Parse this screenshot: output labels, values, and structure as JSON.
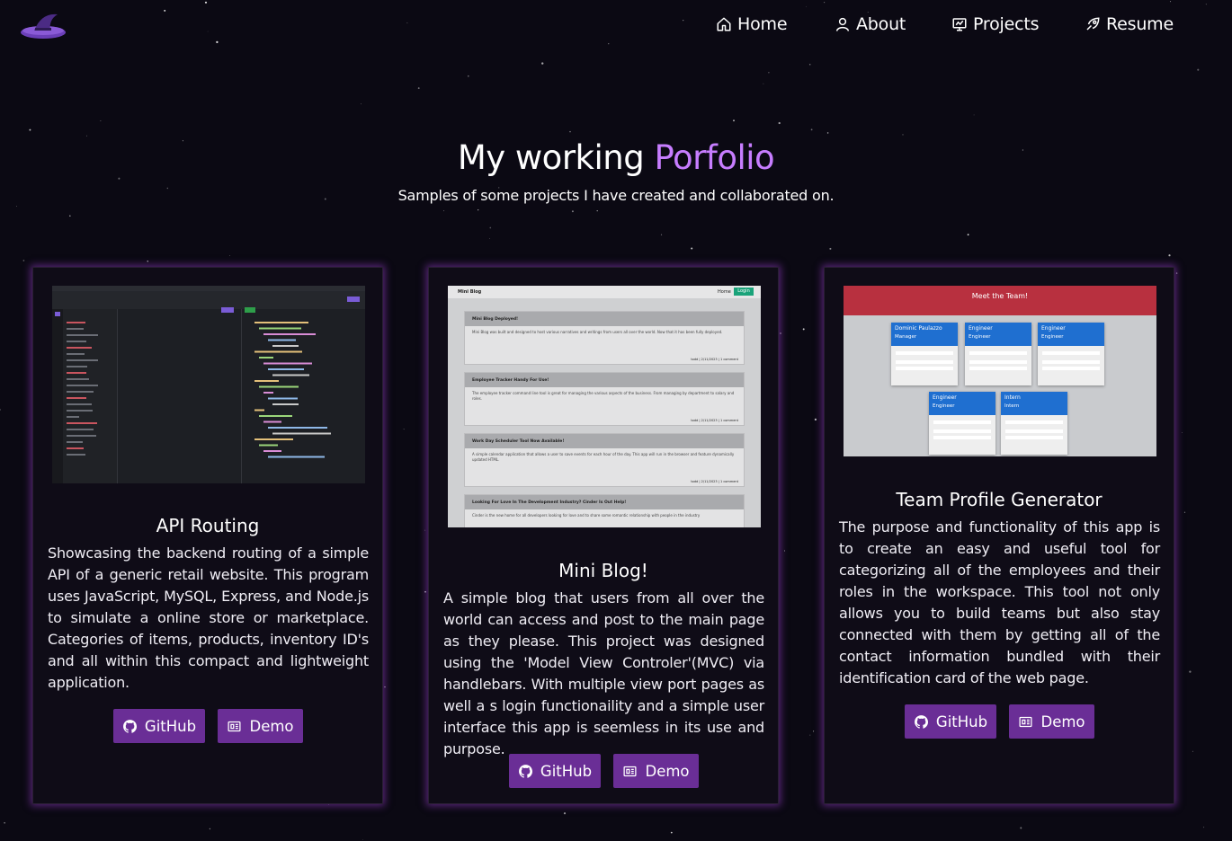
{
  "nav": {
    "items": [
      {
        "label": "Home",
        "icon": "home-icon"
      },
      {
        "label": "About",
        "icon": "user-icon"
      },
      {
        "label": "Projects",
        "icon": "projects-icon"
      },
      {
        "label": "Resume",
        "icon": "resume-icon"
      }
    ]
  },
  "hero": {
    "title_prefix": "My working ",
    "title_accent": "Porfolio",
    "subtitle": "Samples of some projects I have created and collaborated on."
  },
  "colors": {
    "background": "#0b0913",
    "accent": "#c77dff",
    "button": "#6a2e96",
    "card_glow": "#9c3cc8"
  },
  "projects": [
    {
      "title": "API Routing",
      "description": "Showcasing the backend routing of a simple API of a generic retail website. This program uses JavaScript, MySQL, Express, and Node.js to simulate a online store or marketplace. Categories of items, products, inventory ID's and all within this compact and lightweight application.",
      "github_label": "GitHub",
      "demo_label": "Demo"
    },
    {
      "title": "Mini Blog!",
      "description": "A simple blog that users from all over the world can access and post to the main page as they please. This project was designed using the 'Model View Controler'(MVC) via handlebars. With multiple view port pages as well a s login functionaility and a simple user interface this app is seemless in its use and purpose.",
      "github_label": "GitHub",
      "demo_label": "Demo",
      "screenshot": {
        "brand": "Mini Blog",
        "nav_home": "Home",
        "nav_login": "Login",
        "posts": [
          {
            "title": "Mini Blog Deployed!",
            "body": "Mini Blog was built and designed to host various narratives and writings from users all over the world. Now that it has been fully deployed.",
            "meta": "todd | 2/11/2023 | 1 comment"
          },
          {
            "title": "Employee Tracker Handy For Use!",
            "body": "The employee tracker command line tool is great for managing the various aspects of the business. From managing by department to salary and roles.",
            "meta": "todd | 2/11/2023 | 1 comment"
          },
          {
            "title": "Work Day Scheduler Tool Now Available!",
            "body": "A simple calendar application that allows a user to save events for each hour of the day. This app will run in the browser and feature dynamically updated HTML.",
            "meta": "todd | 2/11/2023 | 1 comment"
          },
          {
            "title": "Looking For Love In The Development Industry? Cinder Is Out Help!",
            "body": "Cinder is the new home for all developers looking for love and to share some romantic relationship with people in the industry",
            "meta": ""
          }
        ]
      }
    },
    {
      "title": "Team Profile Generator",
      "description": "The purpose and functionality of this app is to create an easy and useful tool for categorizing all of the employees and their roles in the workspace. This tool not only allows you to build teams but also stay connected with them by getting all of the contact information bundled with their identification card of the web page.",
      "github_label": "GitHub",
      "demo_label": "Demo",
      "screenshot": {
        "header": "Meet the Team!",
        "members": [
          {
            "name": "Dominic Paulazzo",
            "role": "Manager"
          },
          {
            "name": "Engineer",
            "role": "Engineer"
          },
          {
            "name": "Engineer",
            "role": "Engineer"
          },
          {
            "name": "Engineer",
            "role": "Engineer"
          },
          {
            "name": "Intern",
            "role": "Intern"
          }
        ]
      }
    }
  ]
}
